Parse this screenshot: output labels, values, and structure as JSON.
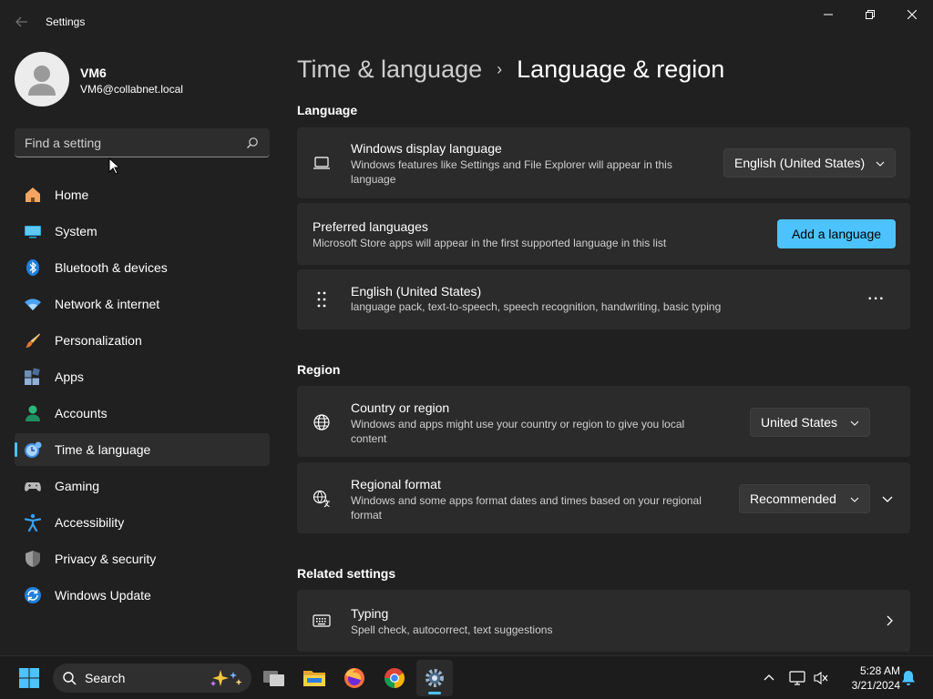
{
  "window": {
    "title": "Settings"
  },
  "user": {
    "name": "VM6",
    "email": "VM6@collabnet.local"
  },
  "search": {
    "placeholder": "Find a setting"
  },
  "sidebar": {
    "items": [
      {
        "label": "Home",
        "icon": "home-icon"
      },
      {
        "label": "System",
        "icon": "system-icon"
      },
      {
        "label": "Bluetooth & devices",
        "icon": "bluetooth-icon"
      },
      {
        "label": "Network & internet",
        "icon": "wifi-icon"
      },
      {
        "label": "Personalization",
        "icon": "brush-icon"
      },
      {
        "label": "Apps",
        "icon": "apps-icon"
      },
      {
        "label": "Accounts",
        "icon": "accounts-icon"
      },
      {
        "label": "Time & language",
        "icon": "time-language-icon",
        "active": true
      },
      {
        "label": "Gaming",
        "icon": "gamepad-icon"
      },
      {
        "label": "Accessibility",
        "icon": "accessibility-icon"
      },
      {
        "label": "Privacy & security",
        "icon": "shield-icon"
      },
      {
        "label": "Windows Update",
        "icon": "update-icon"
      }
    ]
  },
  "breadcrumb": {
    "parent": "Time & language",
    "separator": "›",
    "current": "Language & region"
  },
  "language": {
    "section_title": "Language",
    "display": {
      "title": "Windows display language",
      "desc": "Windows features like Settings and File Explorer will appear in this language",
      "value": "English (United States)"
    },
    "preferred": {
      "title": "Preferred languages",
      "desc": "Microsoft Store apps will appear in the first supported language in this list",
      "button": "Add a language"
    },
    "entry": {
      "title": "English (United States)",
      "desc": "language pack, text-to-speech, speech recognition, handwriting, basic typing",
      "more": "···"
    }
  },
  "region": {
    "section_title": "Region",
    "country": {
      "title": "Country or region",
      "desc": "Windows and apps might use your country or region to give you local content",
      "value": "United States"
    },
    "format": {
      "title": "Regional format",
      "desc": "Windows and some apps format dates and times based on your regional format",
      "value": "Recommended"
    }
  },
  "related": {
    "section_title": "Related settings",
    "typing": {
      "title": "Typing",
      "desc": "Spell check, autocorrect, text suggestions"
    }
  },
  "taskbar": {
    "search_label": "Search",
    "time": "5:28 AM",
    "date": "3/21/2024"
  },
  "colors": {
    "accent": "#4cc2ff",
    "background": "#202020",
    "card": "#2b2b2b"
  }
}
